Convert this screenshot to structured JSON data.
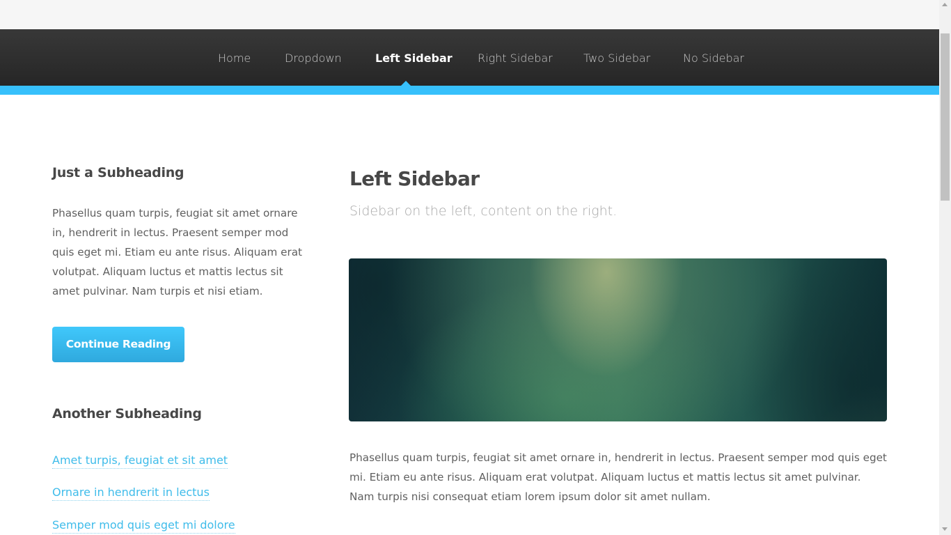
{
  "nav": {
    "items": [
      {
        "label": "Home"
      },
      {
        "label": "Dropdown"
      },
      {
        "label": "Left Sidebar"
      },
      {
        "label": "Right Sidebar"
      },
      {
        "label": "Two Sidebar"
      },
      {
        "label": "No Sidebar"
      }
    ],
    "active": "Left Sidebar"
  },
  "sidebar": {
    "heading1": "Just a Subheading",
    "text": "Phasellus quam turpis, feugiat sit amet ornare in, hendrerit in lectus. Praesent semper mod quis eget mi. Etiam eu ante risus. Aliquam erat volutpat. Aliquam luctus et mattis lectus sit amet pulvinar. Nam turpis et nisi etiam.",
    "button_label": "Continue Reading",
    "heading2": "Another Subheading",
    "links": [
      {
        "label": "Amet turpis, feugiat et sit amet"
      },
      {
        "label": "Ornare in hendrerit in lectus"
      },
      {
        "label": "Semper mod quis eget mi dolore"
      }
    ]
  },
  "main": {
    "title": "Left Sidebar",
    "subtitle": "Sidebar on the left, content on the right.",
    "paragraph": "Phasellus quam turpis, feugiat sit amet ornare in, hendrerit in lectus. Praesent semper mod quis eget mi. Etiam eu ante risus. Aliquam erat volutpat. Aliquam luctus et mattis lectus sit amet pulvinar. Nam turpis nisi consequat etiam lorem ipsum dolor sit amet nullam."
  },
  "colors": {
    "accent": "#37c0fb",
    "nav_background": "#2f2f2f",
    "heading": "#474747",
    "link": "#3fbcea"
  }
}
